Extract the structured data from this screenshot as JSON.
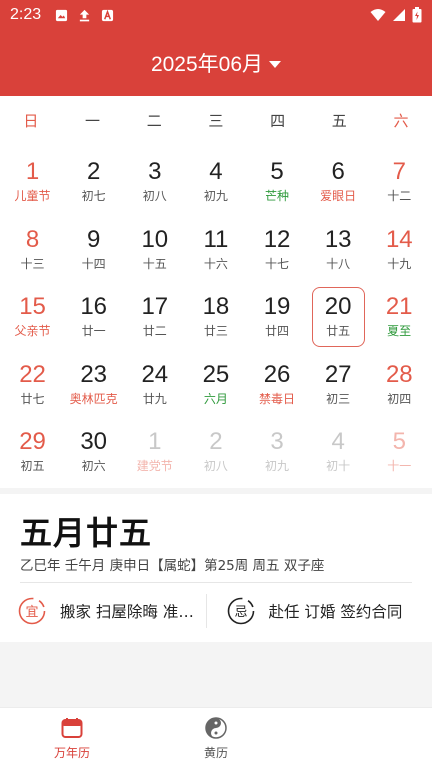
{
  "status_bar": {
    "time": "2:23"
  },
  "header": {
    "title": "2025年06月"
  },
  "weekdays": [
    "日",
    "一",
    "二",
    "三",
    "四",
    "五",
    "六"
  ],
  "weeks": [
    [
      {
        "day": "1",
        "sub": "儿童节"
      },
      {
        "day": "2",
        "sub": "初七"
      },
      {
        "day": "3",
        "sub": "初八"
      },
      {
        "day": "4",
        "sub": "初九"
      },
      {
        "day": "5",
        "sub": "芒种"
      },
      {
        "day": "6",
        "sub": "爱眼日"
      },
      {
        "day": "7",
        "sub": "十二"
      }
    ],
    [
      {
        "day": "8",
        "sub": "十三"
      },
      {
        "day": "9",
        "sub": "十四"
      },
      {
        "day": "10",
        "sub": "十五"
      },
      {
        "day": "11",
        "sub": "十六"
      },
      {
        "day": "12",
        "sub": "十七"
      },
      {
        "day": "13",
        "sub": "十八"
      },
      {
        "day": "14",
        "sub": "十九"
      }
    ],
    [
      {
        "day": "15",
        "sub": "父亲节"
      },
      {
        "day": "16",
        "sub": "廿一"
      },
      {
        "day": "17",
        "sub": "廿二"
      },
      {
        "day": "18",
        "sub": "廿三"
      },
      {
        "day": "19",
        "sub": "廿四"
      },
      {
        "day": "20",
        "sub": "廿五"
      },
      {
        "day": "21",
        "sub": "夏至"
      }
    ],
    [
      {
        "day": "22",
        "sub": "廿七"
      },
      {
        "day": "23",
        "sub": "奥林匹克"
      },
      {
        "day": "24",
        "sub": "廿九"
      },
      {
        "day": "25",
        "sub": "六月"
      },
      {
        "day": "26",
        "sub": "禁毒日"
      },
      {
        "day": "27",
        "sub": "初三"
      },
      {
        "day": "28",
        "sub": "初四"
      }
    ],
    [
      {
        "day": "29",
        "sub": "初五"
      },
      {
        "day": "30",
        "sub": "初六"
      },
      {
        "day": "1",
        "sub": "建党节"
      },
      {
        "day": "2",
        "sub": "初八"
      },
      {
        "day": "3",
        "sub": "初九"
      },
      {
        "day": "4",
        "sub": "初十"
      },
      {
        "day": "5",
        "sub": "十一"
      }
    ]
  ],
  "detail": {
    "lunar_date": "五月廿五",
    "ganzhi": "乙巳年 壬午月 庚申日【属蛇】第25周 周五 双子座",
    "yi_badge": "宜",
    "yi_text": "搬家 扫屋除晦 准备婚礼",
    "ji_badge": "忌",
    "ji_text": "赴任 订婚 签约合同"
  },
  "tabs": [
    {
      "label": "万年历",
      "icon": "calendar-icon",
      "active": true
    },
    {
      "label": "黄历",
      "icon": "yin-yang-icon",
      "active": false
    }
  ],
  "colors": {
    "accent": "#d9413a",
    "holiday": "#e35b4a",
    "solar_term": "#2f9a3c"
  }
}
